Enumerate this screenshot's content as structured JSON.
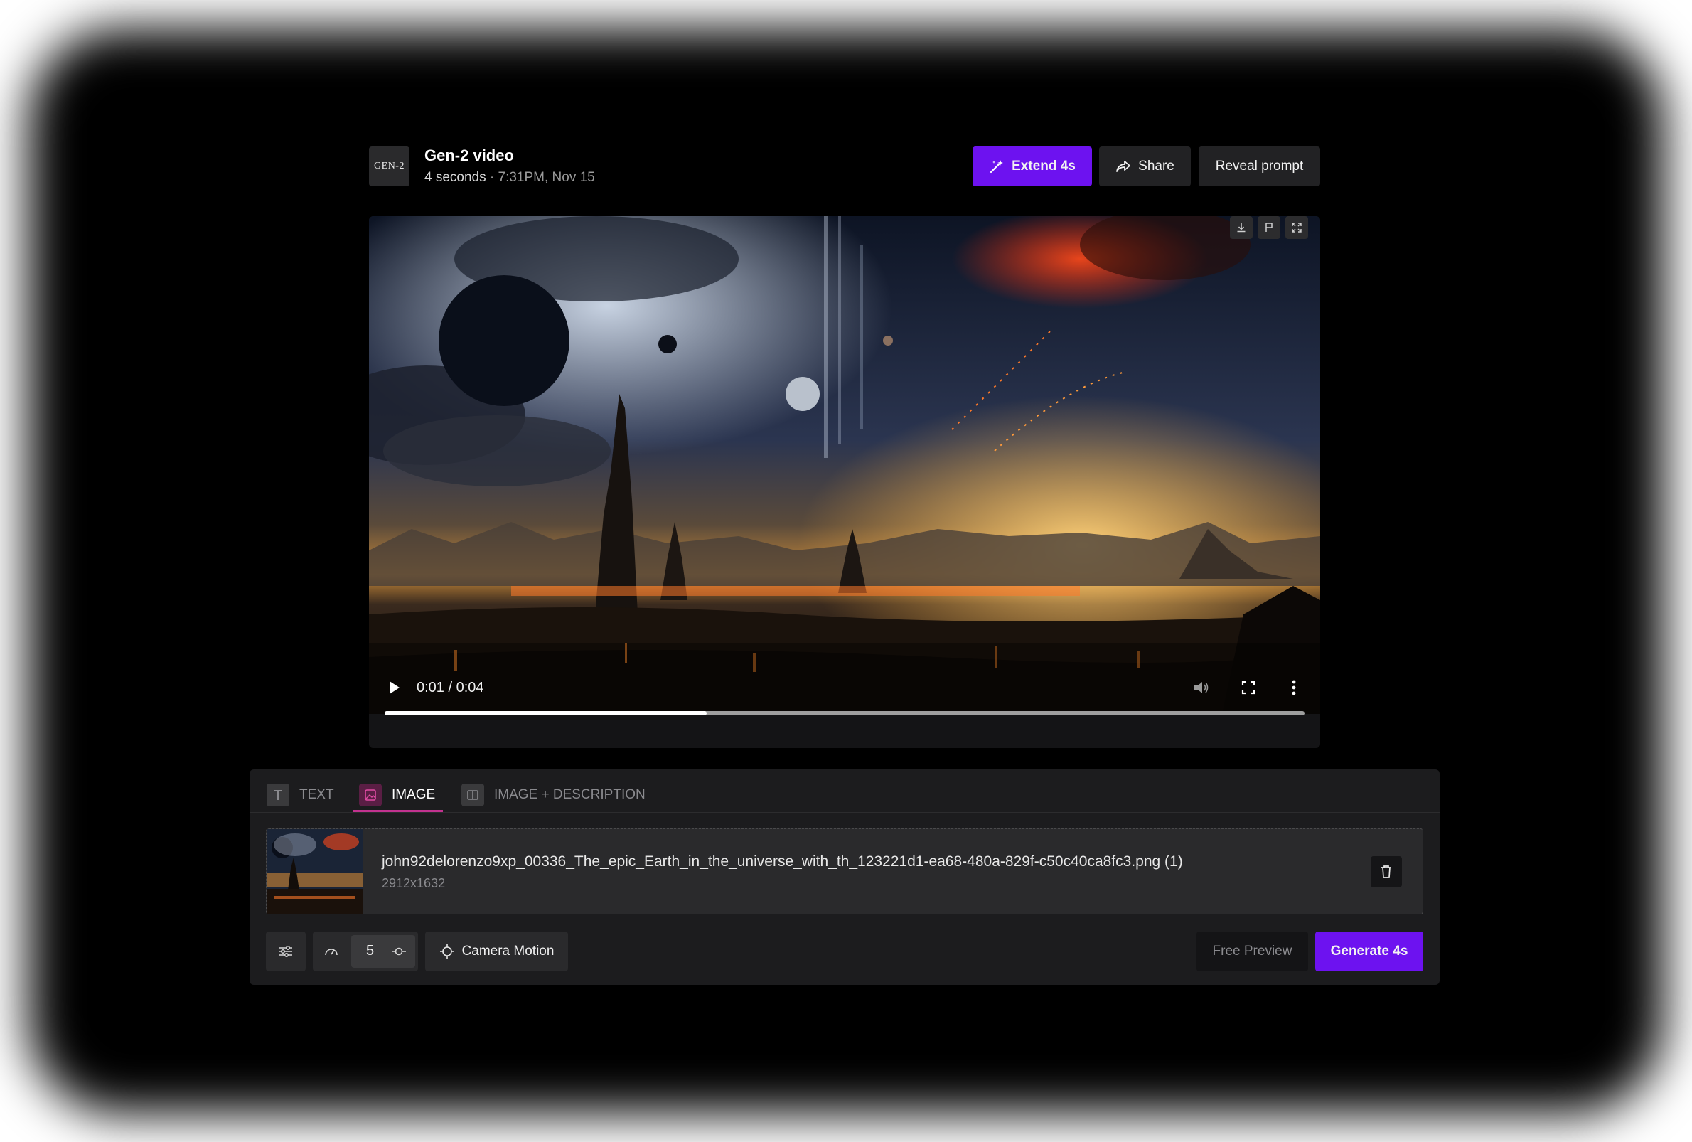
{
  "header": {
    "logo_text": "GEN-2",
    "title": "Gen-2 video",
    "duration": "4 seconds",
    "separator": "·",
    "timestamp": "7:31PM, Nov 15",
    "extend_label": "Extend 4s",
    "share_label": "Share",
    "reveal_label": "Reveal prompt"
  },
  "video": {
    "current_time": "0:01",
    "time_separator": "/",
    "total_time": "0:04",
    "progress": 0.35,
    "top_icons": [
      "download-icon",
      "flag-icon",
      "expand-icon"
    ],
    "control_icons": [
      "play-icon",
      "volume-icon",
      "fullscreen-icon",
      "more-vertical-icon"
    ]
  },
  "tabs": [
    {
      "label": "TEXT",
      "icon": "text-icon",
      "active": false
    },
    {
      "label": "IMAGE",
      "icon": "image-icon",
      "active": true
    },
    {
      "label": "IMAGE + DESCRIPTION",
      "icon": "split-icon",
      "active": false
    }
  ],
  "file": {
    "name": "john92delorenzo9xp_00336_The_epic_Earth_in_the_universe_with_th_123221d1-ea68-480a-829f-c50c40ca8fc3.png (1)",
    "dimensions": "2912x1632"
  },
  "toolbar": {
    "motion_value": "5",
    "camera_motion_label": "Camera Motion",
    "free_preview_label": "Free Preview",
    "generate_label": "Generate 4s"
  },
  "colors": {
    "accent": "#6d12f0",
    "tab_underline": "#c2328f",
    "surface": "#1c1c1e"
  }
}
